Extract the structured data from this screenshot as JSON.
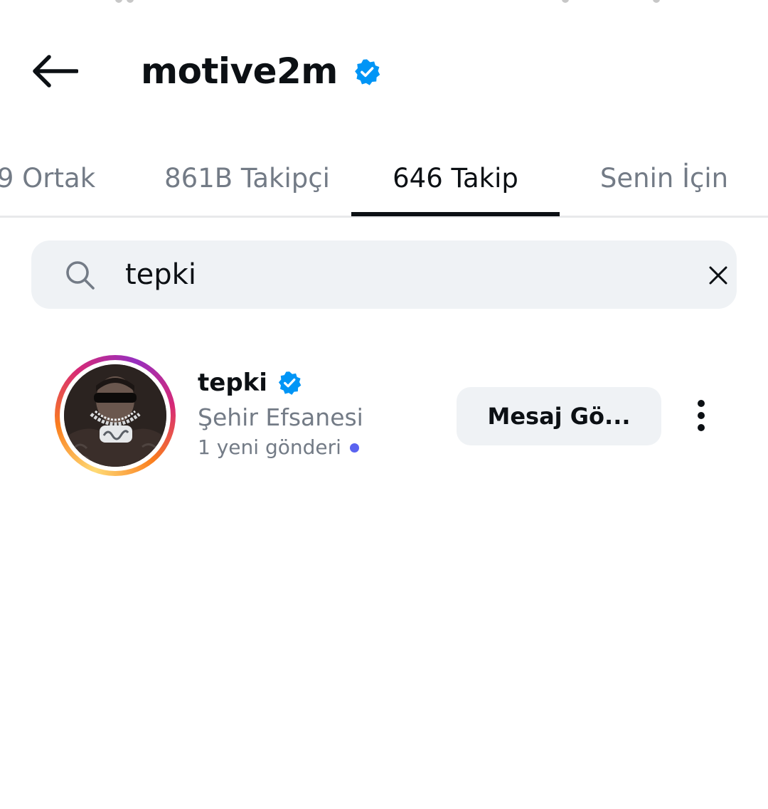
{
  "header": {
    "title": "motive2m"
  },
  "tabs": [
    {
      "label": "9 Ortak"
    },
    {
      "label": "861B Takipçi"
    },
    {
      "label": "646 Takip",
      "active": true
    },
    {
      "label": "Senin İçin"
    }
  ],
  "search": {
    "value": "tepki"
  },
  "results": [
    {
      "username": "tepki",
      "verified": true,
      "full_name": "Şehir Efsanesi",
      "new_posts": "1 yeni gönderi",
      "action_label": "Mesaj Gö..."
    }
  ],
  "colors": {
    "verified": "#0095f6",
    "accent_dot": "#5a63f0",
    "secondary_text": "#737b86",
    "tab_indicator": "#0c1014",
    "search_bg": "#eff2f5"
  },
  "icons": {
    "back": "arrow-left-icon",
    "verified": "verified-badge-icon",
    "search": "search-icon",
    "clear": "close-icon",
    "more": "more-vertical-icon"
  }
}
